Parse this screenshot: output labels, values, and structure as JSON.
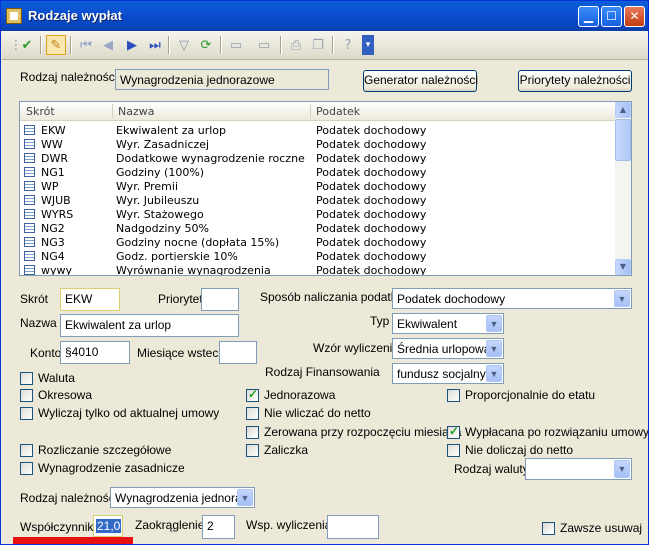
{
  "window": {
    "title": "Rodzaje wypłat"
  },
  "toolbar": {
    "icons": [
      "ok-icon",
      "edit-icon",
      "first-icon",
      "prev-icon",
      "next-icon",
      "last-icon",
      "filter-icon",
      "refresh-icon",
      "window1-icon",
      "window2-icon",
      "print-icon",
      "copy-icon",
      "help-icon",
      "more-icon"
    ]
  },
  "header": {
    "rodzaj_label": "Rodzaj należności",
    "rodzaj_value": "Wynagrodzenia jednorazowe",
    "generator_button": "Generator należności",
    "priorytety_button": "Priorytety należności"
  },
  "list": {
    "columns": [
      "Skrót",
      "Nazwa",
      "Podatek"
    ],
    "rows": [
      {
        "skrot": "EKW",
        "nazwa": "Ekwiwalent za urlop",
        "podatek": "Podatek dochodowy"
      },
      {
        "skrot": "WW",
        "nazwa": "Wyr. Zasadniczej",
        "podatek": "Podatek dochodowy"
      },
      {
        "skrot": "DWR",
        "nazwa": "Dodatkowe wynagrodzenie roczne",
        "podatek": "Podatek dochodowy"
      },
      {
        "skrot": "NG1",
        "nazwa": "Godziny (100%)",
        "podatek": "Podatek dochodowy"
      },
      {
        "skrot": "WP",
        "nazwa": "Wyr. Premii",
        "podatek": "Podatek dochodowy"
      },
      {
        "skrot": "WJUB",
        "nazwa": "Wyr. Jubileuszu",
        "podatek": "Podatek dochodowy"
      },
      {
        "skrot": "WYRS",
        "nazwa": "Wyr. Stażowego",
        "podatek": "Podatek dochodowy"
      },
      {
        "skrot": "NG2",
        "nazwa": "Nadgodziny 50%",
        "podatek": "Podatek dochodowy"
      },
      {
        "skrot": "NG3",
        "nazwa": "Godziny nocne (dopłata 15%)",
        "podatek": "Podatek dochodowy"
      },
      {
        "skrot": "NG4",
        "nazwa": "Godz. portierskie 10%",
        "podatek": "Podatek dochodowy"
      },
      {
        "skrot": "wywy",
        "nazwa": "Wyrównanie wynagrodzenia",
        "podatek": "Podatek dochodowy"
      }
    ]
  },
  "form": {
    "skrot_label": "Skrót",
    "skrot_value": "EKW",
    "priorytet_label": "Priorytet",
    "priorytet_value": "",
    "sposob_label": "Sposób naliczania podatku",
    "sposob_value": "Podatek dochodowy",
    "nazwa_label": "Nazwa",
    "nazwa_value": "Ekwiwalent za urlop",
    "typ_label": "Typ",
    "typ_value": "Ekwiwalent",
    "konto_label": "Konto",
    "konto_value": "§4010",
    "miesiace_label": "Miesiące wstecz",
    "miesiace_value": "",
    "wzor_label": "Wzór wyliczenia",
    "wzor_value": "Średnia urlopowa",
    "finans_label": "Rodzaj Finansowania",
    "finans_value": "fundusz socjalny",
    "waluta_label": "Waluta",
    "okresowa_label": "Okresowa",
    "jednorazowa_label": "Jednorazowa",
    "proporcjonalnie_label": "Proporcjonalnie do etatu",
    "wyliczaj_label": "Wyliczaj tylko od aktualnej umowy",
    "nie_wliczac_label": "Nie wliczać do netto",
    "zerowana_label": "Zerowana przy rozpoczęciu miesiąca",
    "wyplacana_label": "Wypłacana po rozwiązaniu umowy",
    "rozliczanie_label": "Rozliczanie szczegółowe",
    "zaliczka_label": "Zaliczka",
    "nie_doliczaj_label": "Nie doliczaj do netto",
    "wynagrodzenie_label": "Wynagrodzenie zasadnicze",
    "rodzaj_waluty_label": "Rodzaj waluty",
    "rodzaj_waluty_value": "",
    "rodzaj_nal_label": "Rodzaj należności",
    "rodzaj_nal_value": "Wynagrodzenia jednorazc",
    "wspolczynnik_label": "Współczynnik",
    "wspolczynnik_value": "21,0",
    "zaokraglenie_label": "Zaokrąglenie",
    "zaokraglenie_value": "2",
    "wsp_wyliczenia_label": "Wsp. wyliczenia",
    "wsp_wyliczenia_value": "",
    "zawsze_usuwaj_label": "Zawsze usuwaj"
  },
  "checked": {
    "jednorazowa": true,
    "wyplacana": true
  },
  "colors": {
    "title_bar": "#0a5fd8",
    "selection": "#316ac5",
    "highlight": "#e81010"
  }
}
